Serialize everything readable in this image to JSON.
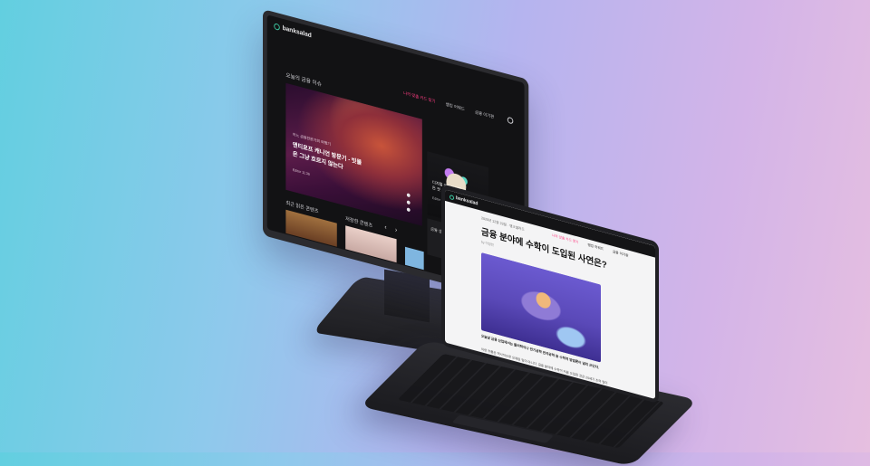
{
  "monitor": {
    "logo": "banksalad",
    "nav": {
      "item1": "나의 맞춤 카드 찾기",
      "item2": "뱅킹 어워드",
      "item3": "금융 이기판"
    },
    "section_title": "오늘의 금융 이슈",
    "hero": {
      "tag": "어느 금융전문가의 여행기",
      "headline": "앤티로프 캐니언 방문기 - 빗물은 그냥 흐르지 않는다",
      "meta": "Editor 11:36"
    },
    "side_card": {
      "title": "디지털 아트에 대한 모든 것",
      "meta": "Editor 9:21"
    },
    "side_card2": {
      "title": "금융 생활"
    },
    "recent_title": "최근 읽은 콘텐츠",
    "popular_title": "저장한 콘텐츠",
    "arrows": "‹ ›"
  },
  "laptop": {
    "logo": "banksalad",
    "nav": {
      "item1": "나의 맞춤 카드 찾기",
      "item2": "뱅킹 어워드",
      "item3": "금융 이기판"
    },
    "breadcrumb": "2020년 12월 23일 · 뱅크샐러드",
    "title": "금융 분야에 수학이 도입된 사연은?",
    "author": "by 이정민",
    "body1": "오늘날 금융 산업에서는 물리학이나 전기공학 전자공학 등 수학적 방법론이 널리 쓰인다.",
    "body2": "이런 흐름은 역사적으로 오래된 일이 아니다. 금융 분야에 수학이 처음 도입된 것은 20세기 초의 일이다."
  }
}
